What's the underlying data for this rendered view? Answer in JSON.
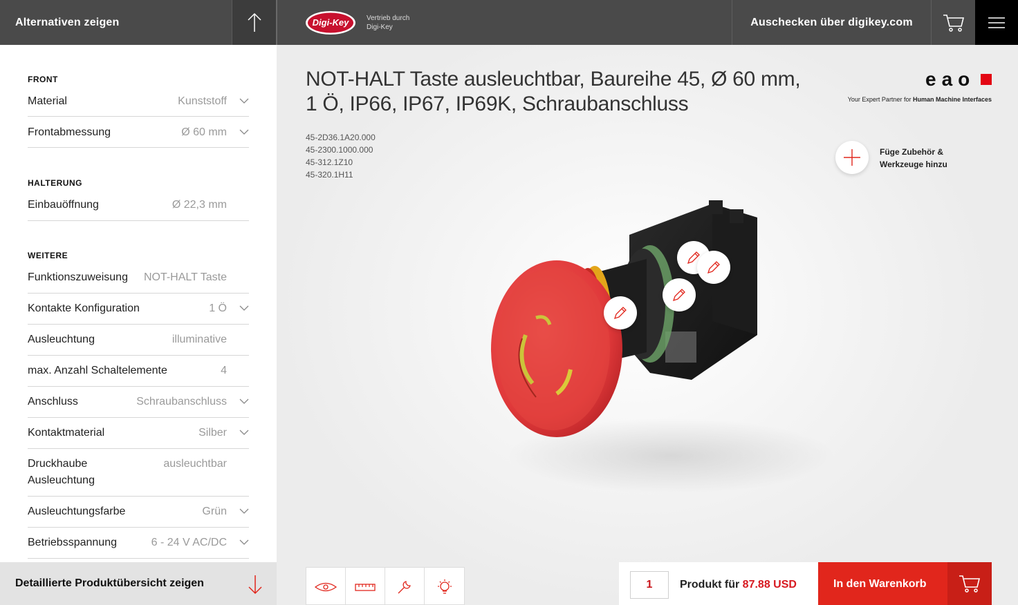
{
  "topbar": {
    "alternatives_label": "Alternativen zeigen",
    "dk_logo_text": "Digi-Key",
    "vertrieb_line1": "Vertrieb durch",
    "vertrieb_line2": "Digi-Key",
    "checkout_label": "Auschecken über digikey.com"
  },
  "left": {
    "sections": {
      "front": "FRONT",
      "halterung": "HALTERUNG",
      "weitere": "WEITERE"
    },
    "rows": [
      {
        "label": "Material",
        "value": "Kunststoff"
      },
      {
        "label": "Frontabmessung",
        "value": "Ø 60 mm"
      },
      {
        "label": "Einbauöffnung",
        "value": "Ø 22,3 mm"
      },
      {
        "label": "Funktionszuweisung",
        "value": "NOT-HALT Taste"
      },
      {
        "label": "Kontakte Konfiguration",
        "value": "1 Ö"
      },
      {
        "label": "Ausleuchtung",
        "value": "illuminative"
      },
      {
        "label": "max. Anzahl Schaltelemente",
        "value": "4"
      },
      {
        "label": "Anschluss",
        "value": "Schraubanschluss"
      },
      {
        "label": "Kontaktmaterial",
        "value": "Silber"
      },
      {
        "label_line1": "Druckhaube",
        "label_line2": "Ausleuchtung",
        "value": "ausleuchtbar"
      },
      {
        "label": "Ausleuchtungsfarbe",
        "value": "Grün"
      },
      {
        "label": "Betriebsspannung",
        "value": "6 - 24 V AC/DC"
      }
    ],
    "detail_label": "Detaillierte Produktübersicht zeigen"
  },
  "main": {
    "title": "NOT-HALT Taste ausleuchtbar, Baureihe 45, Ø 60 mm, 1 Ö, IP66, IP67, IP69K, Schraubanschluss",
    "codes": [
      "45-2D36.1A20.000",
      "45-2300.1000.000",
      "45-312.1Z10",
      "45-320.1H11"
    ],
    "brand": "eao",
    "brand_tag_prefix": "Your Expert Partner for ",
    "brand_tag_bold": "Human Machine Interfaces",
    "add_accessories_line1": "Füge Zubehör &",
    "add_accessories_line2": "Werkzeuge hinzu"
  },
  "buy": {
    "quantity": "1",
    "price_prefix": "Produkt für ",
    "price": "87.88 USD",
    "add_to_cart": "In den Warenkorb"
  },
  "colors": {
    "accent_red": "#e1261c",
    "dark_bar": "#4a4a4a"
  }
}
